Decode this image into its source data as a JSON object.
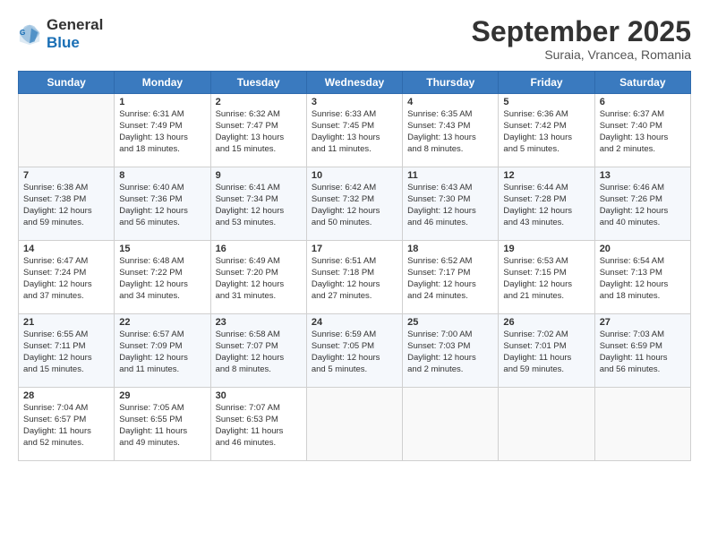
{
  "header": {
    "logo_general": "General",
    "logo_blue": "Blue",
    "month": "September 2025",
    "location": "Suraia, Vrancea, Romania"
  },
  "days_of_week": [
    "Sunday",
    "Monday",
    "Tuesday",
    "Wednesday",
    "Thursday",
    "Friday",
    "Saturday"
  ],
  "weeks": [
    [
      {
        "day": "",
        "lines": []
      },
      {
        "day": "1",
        "lines": [
          "Sunrise: 6:31 AM",
          "Sunset: 7:49 PM",
          "Daylight: 13 hours",
          "and 18 minutes."
        ]
      },
      {
        "day": "2",
        "lines": [
          "Sunrise: 6:32 AM",
          "Sunset: 7:47 PM",
          "Daylight: 13 hours",
          "and 15 minutes."
        ]
      },
      {
        "day": "3",
        "lines": [
          "Sunrise: 6:33 AM",
          "Sunset: 7:45 PM",
          "Daylight: 13 hours",
          "and 11 minutes."
        ]
      },
      {
        "day": "4",
        "lines": [
          "Sunrise: 6:35 AM",
          "Sunset: 7:43 PM",
          "Daylight: 13 hours",
          "and 8 minutes."
        ]
      },
      {
        "day": "5",
        "lines": [
          "Sunrise: 6:36 AM",
          "Sunset: 7:42 PM",
          "Daylight: 13 hours",
          "and 5 minutes."
        ]
      },
      {
        "day": "6",
        "lines": [
          "Sunrise: 6:37 AM",
          "Sunset: 7:40 PM",
          "Daylight: 13 hours",
          "and 2 minutes."
        ]
      }
    ],
    [
      {
        "day": "7",
        "lines": [
          "Sunrise: 6:38 AM",
          "Sunset: 7:38 PM",
          "Daylight: 12 hours",
          "and 59 minutes."
        ]
      },
      {
        "day": "8",
        "lines": [
          "Sunrise: 6:40 AM",
          "Sunset: 7:36 PM",
          "Daylight: 12 hours",
          "and 56 minutes."
        ]
      },
      {
        "day": "9",
        "lines": [
          "Sunrise: 6:41 AM",
          "Sunset: 7:34 PM",
          "Daylight: 12 hours",
          "and 53 minutes."
        ]
      },
      {
        "day": "10",
        "lines": [
          "Sunrise: 6:42 AM",
          "Sunset: 7:32 PM",
          "Daylight: 12 hours",
          "and 50 minutes."
        ]
      },
      {
        "day": "11",
        "lines": [
          "Sunrise: 6:43 AM",
          "Sunset: 7:30 PM",
          "Daylight: 12 hours",
          "and 46 minutes."
        ]
      },
      {
        "day": "12",
        "lines": [
          "Sunrise: 6:44 AM",
          "Sunset: 7:28 PM",
          "Daylight: 12 hours",
          "and 43 minutes."
        ]
      },
      {
        "day": "13",
        "lines": [
          "Sunrise: 6:46 AM",
          "Sunset: 7:26 PM",
          "Daylight: 12 hours",
          "and 40 minutes."
        ]
      }
    ],
    [
      {
        "day": "14",
        "lines": [
          "Sunrise: 6:47 AM",
          "Sunset: 7:24 PM",
          "Daylight: 12 hours",
          "and 37 minutes."
        ]
      },
      {
        "day": "15",
        "lines": [
          "Sunrise: 6:48 AM",
          "Sunset: 7:22 PM",
          "Daylight: 12 hours",
          "and 34 minutes."
        ]
      },
      {
        "day": "16",
        "lines": [
          "Sunrise: 6:49 AM",
          "Sunset: 7:20 PM",
          "Daylight: 12 hours",
          "and 31 minutes."
        ]
      },
      {
        "day": "17",
        "lines": [
          "Sunrise: 6:51 AM",
          "Sunset: 7:18 PM",
          "Daylight: 12 hours",
          "and 27 minutes."
        ]
      },
      {
        "day": "18",
        "lines": [
          "Sunrise: 6:52 AM",
          "Sunset: 7:17 PM",
          "Daylight: 12 hours",
          "and 24 minutes."
        ]
      },
      {
        "day": "19",
        "lines": [
          "Sunrise: 6:53 AM",
          "Sunset: 7:15 PM",
          "Daylight: 12 hours",
          "and 21 minutes."
        ]
      },
      {
        "day": "20",
        "lines": [
          "Sunrise: 6:54 AM",
          "Sunset: 7:13 PM",
          "Daylight: 12 hours",
          "and 18 minutes."
        ]
      }
    ],
    [
      {
        "day": "21",
        "lines": [
          "Sunrise: 6:55 AM",
          "Sunset: 7:11 PM",
          "Daylight: 12 hours",
          "and 15 minutes."
        ]
      },
      {
        "day": "22",
        "lines": [
          "Sunrise: 6:57 AM",
          "Sunset: 7:09 PM",
          "Daylight: 12 hours",
          "and 11 minutes."
        ]
      },
      {
        "day": "23",
        "lines": [
          "Sunrise: 6:58 AM",
          "Sunset: 7:07 PM",
          "Daylight: 12 hours",
          "and 8 minutes."
        ]
      },
      {
        "day": "24",
        "lines": [
          "Sunrise: 6:59 AM",
          "Sunset: 7:05 PM",
          "Daylight: 12 hours",
          "and 5 minutes."
        ]
      },
      {
        "day": "25",
        "lines": [
          "Sunrise: 7:00 AM",
          "Sunset: 7:03 PM",
          "Daylight: 12 hours",
          "and 2 minutes."
        ]
      },
      {
        "day": "26",
        "lines": [
          "Sunrise: 7:02 AM",
          "Sunset: 7:01 PM",
          "Daylight: 11 hours",
          "and 59 minutes."
        ]
      },
      {
        "day": "27",
        "lines": [
          "Sunrise: 7:03 AM",
          "Sunset: 6:59 PM",
          "Daylight: 11 hours",
          "and 56 minutes."
        ]
      }
    ],
    [
      {
        "day": "28",
        "lines": [
          "Sunrise: 7:04 AM",
          "Sunset: 6:57 PM",
          "Daylight: 11 hours",
          "and 52 minutes."
        ]
      },
      {
        "day": "29",
        "lines": [
          "Sunrise: 7:05 AM",
          "Sunset: 6:55 PM",
          "Daylight: 11 hours",
          "and 49 minutes."
        ]
      },
      {
        "day": "30",
        "lines": [
          "Sunrise: 7:07 AM",
          "Sunset: 6:53 PM",
          "Daylight: 11 hours",
          "and 46 minutes."
        ]
      },
      {
        "day": "",
        "lines": []
      },
      {
        "day": "",
        "lines": []
      },
      {
        "day": "",
        "lines": []
      },
      {
        "day": "",
        "lines": []
      }
    ]
  ]
}
